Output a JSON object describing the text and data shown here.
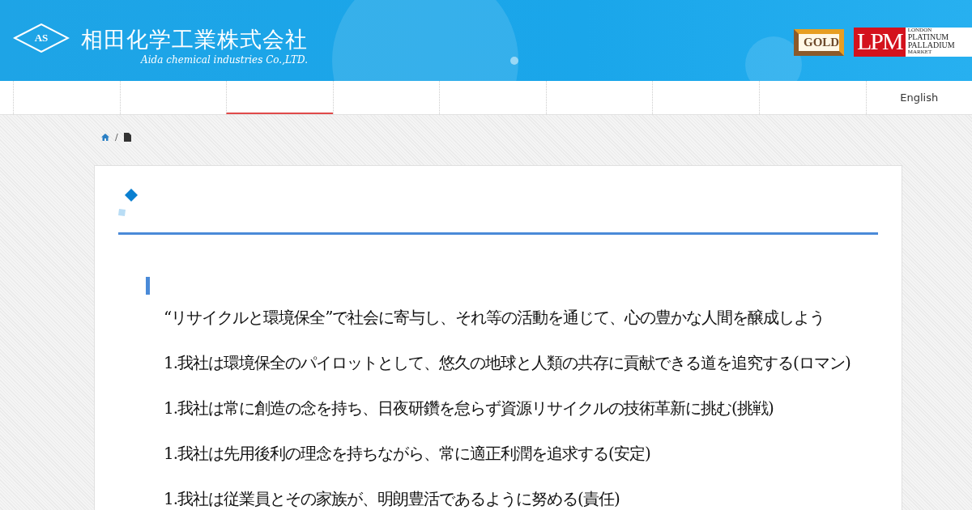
{
  "header": {
    "company_name": "相田化学工業株式会社",
    "company_name_en": "Aida chemical industries Co.,LTD.",
    "logo_mark": "AS",
    "badges": [
      {
        "kind": "gold",
        "text": "GOLD"
      },
      {
        "kind": "lpm",
        "text": "LPM",
        "lines": [
          "LONDON",
          "PLATINUM",
          "PALLADIUM",
          "MARKET"
        ]
      }
    ]
  },
  "nav": {
    "items": [
      {
        "selected": false
      },
      {
        "selected": false
      },
      {
        "selected": true
      },
      {
        "selected": false
      },
      {
        "selected": false
      },
      {
        "selected": false
      },
      {
        "selected": false
      },
      {
        "selected": false
      },
      {
        "label": "English",
        "selected": false
      }
    ]
  },
  "breadcrumb": {
    "separator": "/"
  },
  "content": {
    "paragraphs": [
      "“リサイクルと環境保全”で社会に寄与し、それ等の活動を通じて、心の豊かな人間を醸成しよう",
      "1.我社は環境保全のパイロットとして、悠久の地球と人類の共存に貢献できる道を追究する(ロマン)",
      "1.我社は常に創造の念を持ち、日夜研鑽を怠らず資源リサイクルの技術革新に挑む(挑戦)",
      "1.我社は先用後利の理念を持ちながら、常に適正利潤を追求する(安定)",
      "1.我社は従業員とその家族が、明朗豊活であるように努める(責任)"
    ]
  }
}
